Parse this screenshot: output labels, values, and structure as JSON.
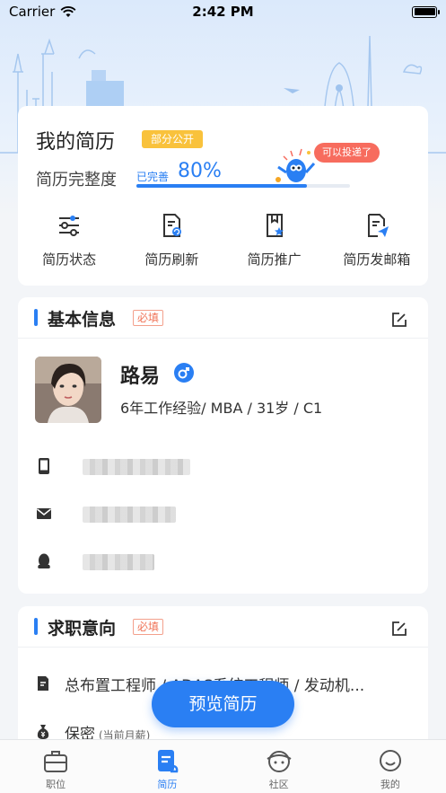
{
  "status_bar": {
    "carrier": "Carrier",
    "time": "2:42 PM"
  },
  "resume": {
    "title": "我的简历",
    "visibility_tag": "部分公开",
    "completeness_label": "简历完整度",
    "completeness_done": "已完善",
    "completeness_percent": "80%",
    "completeness_value": 0.8,
    "bubble": "可以投递了",
    "quick_actions": [
      {
        "label": "简历状态",
        "icon": "sliders-icon"
      },
      {
        "label": "简历刷新",
        "icon": "refresh-doc-icon"
      },
      {
        "label": "简历推广",
        "icon": "promote-doc-icon"
      },
      {
        "label": "简历发邮箱",
        "icon": "send-doc-icon"
      }
    ]
  },
  "basic_info": {
    "title": "基本信息",
    "required_tag": "必填",
    "name": "路易",
    "meta": "6年工作经验/ MBA / 31岁 / C1",
    "contacts": [
      {
        "icon": "phone-icon"
      },
      {
        "icon": "mail-icon"
      },
      {
        "icon": "qq-icon"
      }
    ]
  },
  "job_intent": {
    "title": "求职意向",
    "required_tag": "必填",
    "position": "总布置工程师 / ADAS系统工程师 / 发动机...",
    "salary": "保密",
    "salary_note": "(当前月薪)"
  },
  "preview_button": "预览简历",
  "tabs": [
    {
      "label": "职位",
      "icon": "briefcase-icon",
      "active": false
    },
    {
      "label": "简历",
      "icon": "resume-icon",
      "active": true
    },
    {
      "label": "社区",
      "icon": "community-icon",
      "active": false
    },
    {
      "label": "我的",
      "icon": "profile-icon",
      "active": false
    }
  ],
  "colors": {
    "accent": "#2a7ff3",
    "tag_yellow": "#f9c23c",
    "required": "#f07458",
    "bubble": "#f76c5e"
  }
}
